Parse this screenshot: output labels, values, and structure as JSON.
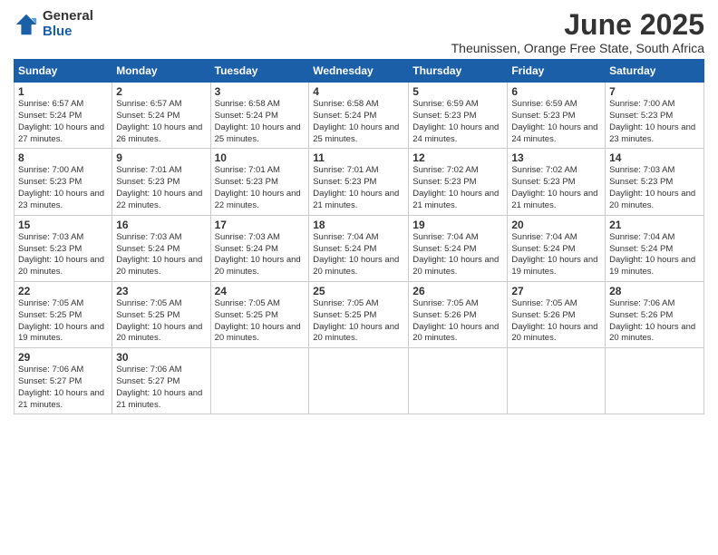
{
  "logo": {
    "general": "General",
    "blue": "Blue"
  },
  "title": "June 2025",
  "subtitle": "Theunissen, Orange Free State, South Africa",
  "headers": [
    "Sunday",
    "Monday",
    "Tuesday",
    "Wednesday",
    "Thursday",
    "Friday",
    "Saturday"
  ],
  "weeks": [
    [
      {
        "day": "1",
        "sunrise": "Sunrise: 6:57 AM",
        "sunset": "Sunset: 5:24 PM",
        "daylight": "Daylight: 10 hours and 27 minutes."
      },
      {
        "day": "2",
        "sunrise": "Sunrise: 6:57 AM",
        "sunset": "Sunset: 5:24 PM",
        "daylight": "Daylight: 10 hours and 26 minutes."
      },
      {
        "day": "3",
        "sunrise": "Sunrise: 6:58 AM",
        "sunset": "Sunset: 5:24 PM",
        "daylight": "Daylight: 10 hours and 25 minutes."
      },
      {
        "day": "4",
        "sunrise": "Sunrise: 6:58 AM",
        "sunset": "Sunset: 5:24 PM",
        "daylight": "Daylight: 10 hours and 25 minutes."
      },
      {
        "day": "5",
        "sunrise": "Sunrise: 6:59 AM",
        "sunset": "Sunset: 5:23 PM",
        "daylight": "Daylight: 10 hours and 24 minutes."
      },
      {
        "day": "6",
        "sunrise": "Sunrise: 6:59 AM",
        "sunset": "Sunset: 5:23 PM",
        "daylight": "Daylight: 10 hours and 24 minutes."
      },
      {
        "day": "7",
        "sunrise": "Sunrise: 7:00 AM",
        "sunset": "Sunset: 5:23 PM",
        "daylight": "Daylight: 10 hours and 23 minutes."
      }
    ],
    [
      {
        "day": "8",
        "sunrise": "Sunrise: 7:00 AM",
        "sunset": "Sunset: 5:23 PM",
        "daylight": "Daylight: 10 hours and 23 minutes."
      },
      {
        "day": "9",
        "sunrise": "Sunrise: 7:01 AM",
        "sunset": "Sunset: 5:23 PM",
        "daylight": "Daylight: 10 hours and 22 minutes."
      },
      {
        "day": "10",
        "sunrise": "Sunrise: 7:01 AM",
        "sunset": "Sunset: 5:23 PM",
        "daylight": "Daylight: 10 hours and 22 minutes."
      },
      {
        "day": "11",
        "sunrise": "Sunrise: 7:01 AM",
        "sunset": "Sunset: 5:23 PM",
        "daylight": "Daylight: 10 hours and 21 minutes."
      },
      {
        "day": "12",
        "sunrise": "Sunrise: 7:02 AM",
        "sunset": "Sunset: 5:23 PM",
        "daylight": "Daylight: 10 hours and 21 minutes."
      },
      {
        "day": "13",
        "sunrise": "Sunrise: 7:02 AM",
        "sunset": "Sunset: 5:23 PM",
        "daylight": "Daylight: 10 hours and 21 minutes."
      },
      {
        "day": "14",
        "sunrise": "Sunrise: 7:03 AM",
        "sunset": "Sunset: 5:23 PM",
        "daylight": "Daylight: 10 hours and 20 minutes."
      }
    ],
    [
      {
        "day": "15",
        "sunrise": "Sunrise: 7:03 AM",
        "sunset": "Sunset: 5:23 PM",
        "daylight": "Daylight: 10 hours and 20 minutes."
      },
      {
        "day": "16",
        "sunrise": "Sunrise: 7:03 AM",
        "sunset": "Sunset: 5:24 PM",
        "daylight": "Daylight: 10 hours and 20 minutes."
      },
      {
        "day": "17",
        "sunrise": "Sunrise: 7:03 AM",
        "sunset": "Sunset: 5:24 PM",
        "daylight": "Daylight: 10 hours and 20 minutes."
      },
      {
        "day": "18",
        "sunrise": "Sunrise: 7:04 AM",
        "sunset": "Sunset: 5:24 PM",
        "daylight": "Daylight: 10 hours and 20 minutes."
      },
      {
        "day": "19",
        "sunrise": "Sunrise: 7:04 AM",
        "sunset": "Sunset: 5:24 PM",
        "daylight": "Daylight: 10 hours and 20 minutes."
      },
      {
        "day": "20",
        "sunrise": "Sunrise: 7:04 AM",
        "sunset": "Sunset: 5:24 PM",
        "daylight": "Daylight: 10 hours and 19 minutes."
      },
      {
        "day": "21",
        "sunrise": "Sunrise: 7:04 AM",
        "sunset": "Sunset: 5:24 PM",
        "daylight": "Daylight: 10 hours and 19 minutes."
      }
    ],
    [
      {
        "day": "22",
        "sunrise": "Sunrise: 7:05 AM",
        "sunset": "Sunset: 5:25 PM",
        "daylight": "Daylight: 10 hours and 19 minutes."
      },
      {
        "day": "23",
        "sunrise": "Sunrise: 7:05 AM",
        "sunset": "Sunset: 5:25 PM",
        "daylight": "Daylight: 10 hours and 20 minutes."
      },
      {
        "day": "24",
        "sunrise": "Sunrise: 7:05 AM",
        "sunset": "Sunset: 5:25 PM",
        "daylight": "Daylight: 10 hours and 20 minutes."
      },
      {
        "day": "25",
        "sunrise": "Sunrise: 7:05 AM",
        "sunset": "Sunset: 5:25 PM",
        "daylight": "Daylight: 10 hours and 20 minutes."
      },
      {
        "day": "26",
        "sunrise": "Sunrise: 7:05 AM",
        "sunset": "Sunset: 5:26 PM",
        "daylight": "Daylight: 10 hours and 20 minutes."
      },
      {
        "day": "27",
        "sunrise": "Sunrise: 7:05 AM",
        "sunset": "Sunset: 5:26 PM",
        "daylight": "Daylight: 10 hours and 20 minutes."
      },
      {
        "day": "28",
        "sunrise": "Sunrise: 7:06 AM",
        "sunset": "Sunset: 5:26 PM",
        "daylight": "Daylight: 10 hours and 20 minutes."
      }
    ],
    [
      {
        "day": "29",
        "sunrise": "Sunrise: 7:06 AM",
        "sunset": "Sunset: 5:27 PM",
        "daylight": "Daylight: 10 hours and 21 minutes."
      },
      {
        "day": "30",
        "sunrise": "Sunrise: 7:06 AM",
        "sunset": "Sunset: 5:27 PM",
        "daylight": "Daylight: 10 hours and 21 minutes."
      },
      null,
      null,
      null,
      null,
      null
    ]
  ]
}
